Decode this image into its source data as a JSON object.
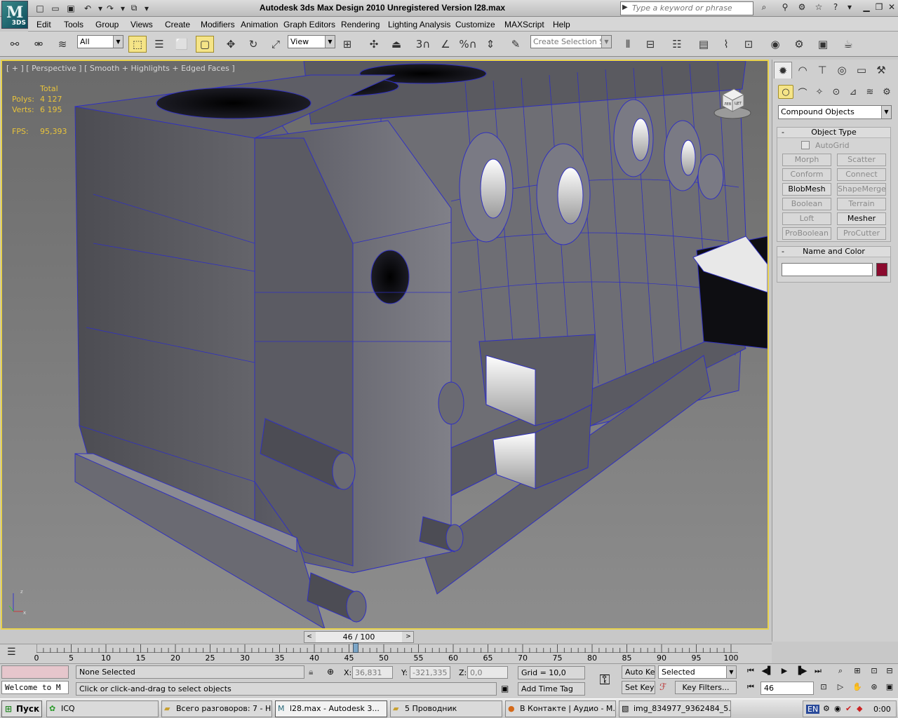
{
  "app": {
    "title": "Autodesk 3ds Max Design 2010    Unregistered Version    l28.max",
    "logo_text": "3DS",
    "logo_letter": "M"
  },
  "help_search": {
    "placeholder": "Type a keyword or phrase"
  },
  "menu": [
    "Edit",
    "Tools",
    "Group",
    "Views",
    "Create",
    "Modifiers",
    "Animation",
    "Graph Editors",
    "Rendering",
    "Lighting Analysis",
    "Customize",
    "MAXScript",
    "Help"
  ],
  "toolbar": {
    "selection_filter": "All",
    "ref_coord": "View",
    "named_selection_placeholder": "Create Selection Se",
    "snap_label": "3",
    "angle_snap_label": "",
    "percent_snap_label": "%"
  },
  "viewport": {
    "label": "[ + ] [ Perspective ] [ Smooth + Highlights + Edged Faces ]",
    "stats": {
      "header": "Total",
      "polys_label": "Polys:",
      "polys_value": "4 127",
      "verts_label": "Verts:",
      "verts_value": "6 195",
      "fps_label": "FPS:",
      "fps_value": "95,393"
    },
    "viewcube_labels": {
      "top": "",
      "left": "ЛЕВ",
      "front": "ЦЕТ"
    }
  },
  "command_panel": {
    "category": "Compound Objects",
    "object_type_title": "Object Type",
    "autogrid_label": "AutoGrid",
    "buttons": [
      {
        "label": "Morph",
        "enabled": false
      },
      {
        "label": "Scatter",
        "enabled": false
      },
      {
        "label": "Conform",
        "enabled": false
      },
      {
        "label": "Connect",
        "enabled": false
      },
      {
        "label": "BlobMesh",
        "enabled": true
      },
      {
        "label": "ShapeMerge",
        "enabled": false
      },
      {
        "label": "Boolean",
        "enabled": false
      },
      {
        "label": "Terrain",
        "enabled": false
      },
      {
        "label": "Loft",
        "enabled": false
      },
      {
        "label": "Mesher",
        "enabled": true
      },
      {
        "label": "ProBoolean",
        "enabled": false
      },
      {
        "label": "ProCutter",
        "enabled": false
      }
    ],
    "name_color_title": "Name and Color",
    "name_value": "",
    "object_color": "#8b0a2e"
  },
  "timeline": {
    "slider_label": "46 / 100",
    "current_frame": 46,
    "total_frames": 100,
    "ticks": [
      "0",
      "5",
      "10",
      "15",
      "20",
      "25",
      "30",
      "35",
      "40",
      "45",
      "50",
      "55",
      "60",
      "65",
      "70",
      "75",
      "80",
      "85",
      "90",
      "95",
      "100"
    ]
  },
  "status": {
    "maxscript_listener": "Welcome to M",
    "selection_info": "None Selected",
    "prompt": "Click or click-and-drag to select objects",
    "x_label": "X:",
    "x_value": "36,831",
    "y_label": "Y:",
    "y_value": "-321,335",
    "z_label": "Z:",
    "z_value": "0,0",
    "grid": "Grid = 10,0",
    "add_time_tag": "Add Time Tag",
    "auto_key": "Auto Key",
    "set_key": "Set Key",
    "key_mode": "Selected",
    "key_filters": "Key Filters...",
    "frame_field": "46"
  },
  "taskbar": {
    "start": "Пуск",
    "tasks": [
      {
        "label": "ICQ",
        "active": false
      },
      {
        "label": "Всего разговоров: 7 - Н...",
        "active": false
      },
      {
        "label": "l28.max - Autodesk 3...",
        "active": true
      },
      {
        "label": "5 Проводник",
        "active": false
      },
      {
        "label": "В Контакте | Аудио - М...",
        "active": false
      },
      {
        "label": "img_834977_9362484_5...",
        "active": false
      }
    ],
    "lang": "EN",
    "clock": "0:00"
  },
  "colors": {
    "accent_yellow": "#e8d24b",
    "stats_text": "#e8c33b",
    "wire_blue": "#3030c0"
  }
}
